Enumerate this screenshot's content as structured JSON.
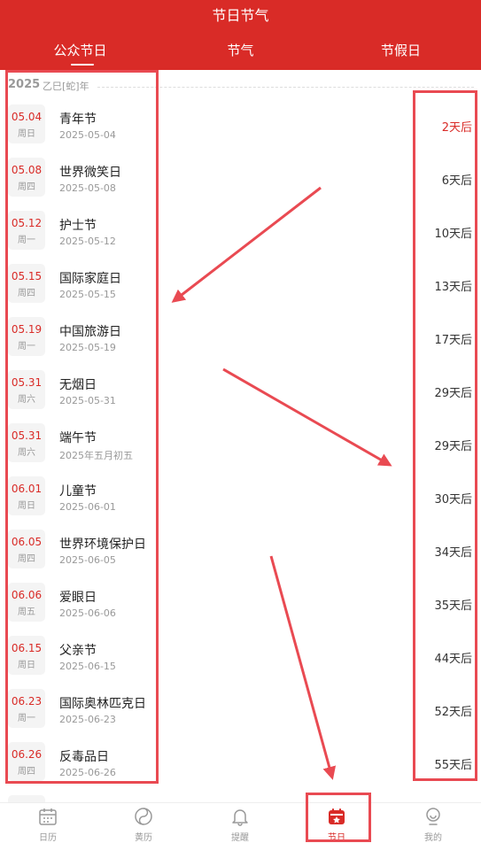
{
  "header": {
    "title": "节日节气",
    "tabs": [
      {
        "label": "公众节日",
        "active": true
      },
      {
        "label": "节气",
        "active": false
      },
      {
        "label": "节假日",
        "active": false
      }
    ]
  },
  "year_section": {
    "year": "2025",
    "ganzhi": "乙巳[蛇]年"
  },
  "festivals": [
    {
      "date": "05.04",
      "weekday": "周日",
      "name": "青年节",
      "sub": "2025-05-04",
      "countdown": "2天后",
      "soon": true
    },
    {
      "date": "05.08",
      "weekday": "周四",
      "name": "世界微笑日",
      "sub": "2025-05-08",
      "countdown": "6天后"
    },
    {
      "date": "05.12",
      "weekday": "周一",
      "name": "护士节",
      "sub": "2025-05-12",
      "countdown": "10天后"
    },
    {
      "date": "05.15",
      "weekday": "周四",
      "name": "国际家庭日",
      "sub": "2025-05-15",
      "countdown": "13天后"
    },
    {
      "date": "05.19",
      "weekday": "周一",
      "name": "中国旅游日",
      "sub": "2025-05-19",
      "countdown": "17天后"
    },
    {
      "date": "05.31",
      "weekday": "周六",
      "name": "无烟日",
      "sub": "2025-05-31",
      "countdown": "29天后"
    },
    {
      "date": "05.31",
      "weekday": "周六",
      "name": "端午节",
      "sub": "2025年五月初五",
      "countdown": "29天后"
    },
    {
      "date": "06.01",
      "weekday": "周日",
      "name": "儿童节",
      "sub": "2025-06-01",
      "countdown": "30天后"
    },
    {
      "date": "06.05",
      "weekday": "周四",
      "name": "世界环境保护日",
      "sub": "2025-06-05",
      "countdown": "34天后"
    },
    {
      "date": "06.06",
      "weekday": "周五",
      "name": "爱眼日",
      "sub": "2025-06-06",
      "countdown": "35天后"
    },
    {
      "date": "06.15",
      "weekday": "周日",
      "name": "父亲节",
      "sub": "2025-06-15",
      "countdown": "44天后"
    },
    {
      "date": "06.23",
      "weekday": "周一",
      "name": "国际奥林匹克日",
      "sub": "2025-06-23",
      "countdown": "52天后"
    },
    {
      "date": "06.26",
      "weekday": "周四",
      "name": "反毒品日",
      "sub": "2025-06-26",
      "countdown": "55天后"
    }
  ],
  "bottom_nav": [
    {
      "label": "日历",
      "icon": "calendar-icon"
    },
    {
      "label": "黄历",
      "icon": "yin-yang-icon"
    },
    {
      "label": "提醒",
      "icon": "bell-icon"
    },
    {
      "label": "节日",
      "icon": "festival-icon",
      "active": true
    },
    {
      "label": "我的",
      "icon": "profile-icon"
    }
  ],
  "colors": {
    "brand_red": "#d92b27",
    "annotation_red": "#e94a52"
  }
}
